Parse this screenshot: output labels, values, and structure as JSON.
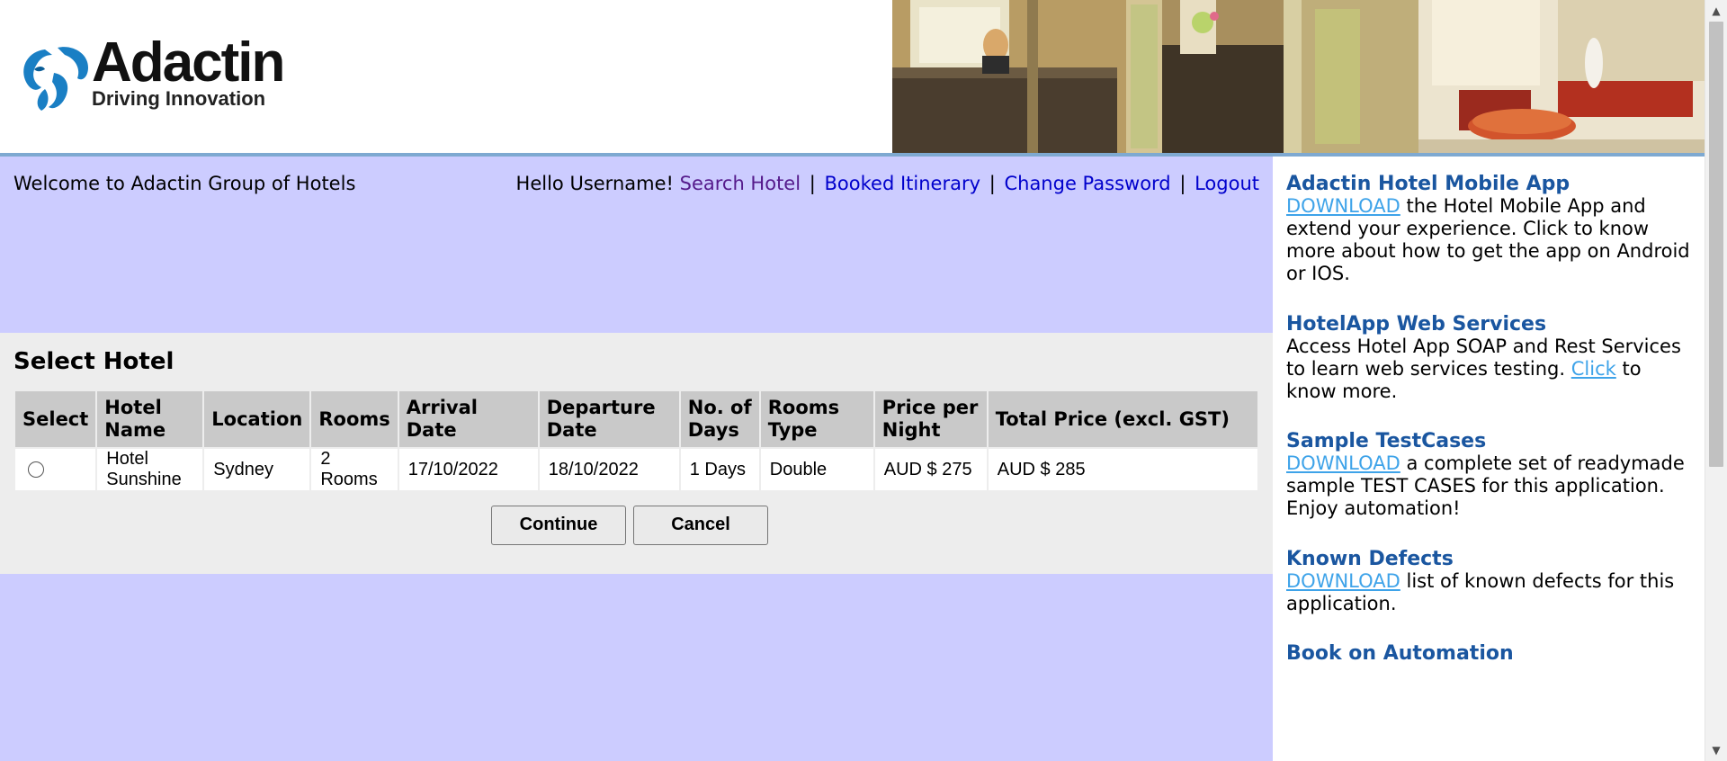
{
  "header": {
    "logo_name": "Adactin",
    "logo_tagline": "Driving Innovation"
  },
  "topbar": {
    "welcome": "Welcome to Adactin Group of Hotels",
    "greeting": "Hello Username!",
    "links": [
      "Search Hotel",
      "Booked Itinerary",
      "Change Password",
      "Logout"
    ],
    "separator": "|"
  },
  "select_hotel": {
    "title": "Select Hotel",
    "columns": [
      "Select",
      "Hotel Name",
      "Location",
      "Rooms",
      "Arrival Date",
      "Departure Date",
      "No. of Days",
      "Rooms Type",
      "Price per Night",
      "Total Price (excl. GST)"
    ],
    "rows": [
      {
        "hotel_name": "Hotel Sunshine",
        "location": "Sydney",
        "rooms": "2 Rooms",
        "arrival": "17/10/2022",
        "departure": "18/10/2022",
        "days": "1 Days",
        "room_type": "Double",
        "price_per_night": "AUD $ 275",
        "total_price": "AUD $ 285"
      }
    ],
    "buttons": {
      "continue": "Continue",
      "cancel": "Cancel"
    }
  },
  "sidebar": {
    "blocks": [
      {
        "title": "Adactin Hotel Mobile App",
        "link": "DOWNLOAD",
        "text": " the Hotel Mobile App and extend your experience. Click to know more about how to get the app on Android or IOS."
      },
      {
        "title": "HotelApp Web Services",
        "text_before": "Access Hotel App SOAP and Rest Services to learn web services testing. ",
        "link": "Click",
        "text_after": " to know more."
      },
      {
        "title": "Sample TestCases",
        "link": "DOWNLOAD",
        "text": " a complete set of readymade sample TEST CASES for this application. Enjoy automation!"
      },
      {
        "title": "Known Defects",
        "link": "DOWNLOAD",
        "text": " list of known defects for this application."
      },
      {
        "title": "Book on Automation"
      }
    ]
  },
  "colors": {
    "main_bg": "#ccccff",
    "panel_bg": "#ededed",
    "header_rule": "#7ea9d1",
    "sidebar_title": "#1a56a0",
    "sidebar_link": "#3ea3e9",
    "nav_link": "#0000cc"
  }
}
